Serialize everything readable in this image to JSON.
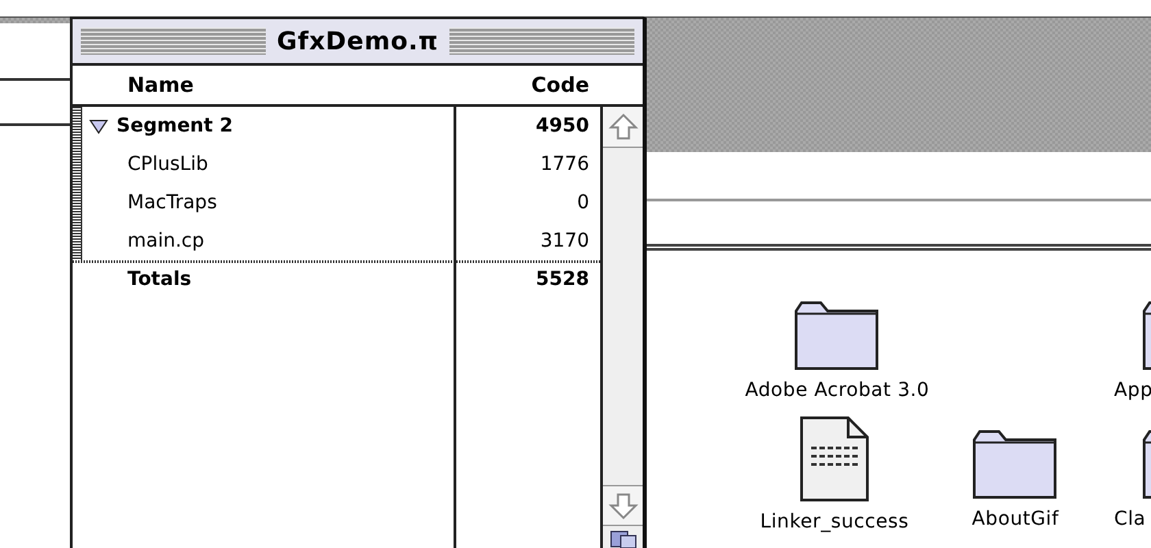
{
  "project_window": {
    "title": "GfxDemo.π",
    "columns": [
      "Name",
      "Code"
    ],
    "rows": [
      {
        "kind": "segment",
        "name": "Segment 2",
        "code": "4950",
        "expanded": true,
        "children": [
          {
            "name": "CPlusLib",
            "code": "1776"
          },
          {
            "name": "MacTraps",
            "code": "0"
          },
          {
            "name": "main.cp",
            "code": "3170"
          }
        ]
      }
    ],
    "totals": {
      "name": "Totals",
      "code": "5528"
    }
  },
  "finder_window": {
    "items": [
      {
        "kind": "folder",
        "label": "Adobe Acrobat 3.0"
      },
      {
        "kind": "folder",
        "label": "App"
      },
      {
        "kind": "document",
        "label": "Linker_success"
      },
      {
        "kind": "folder",
        "label": "AboutGif"
      },
      {
        "kind": "folder",
        "label": "Cla"
      }
    ]
  }
}
